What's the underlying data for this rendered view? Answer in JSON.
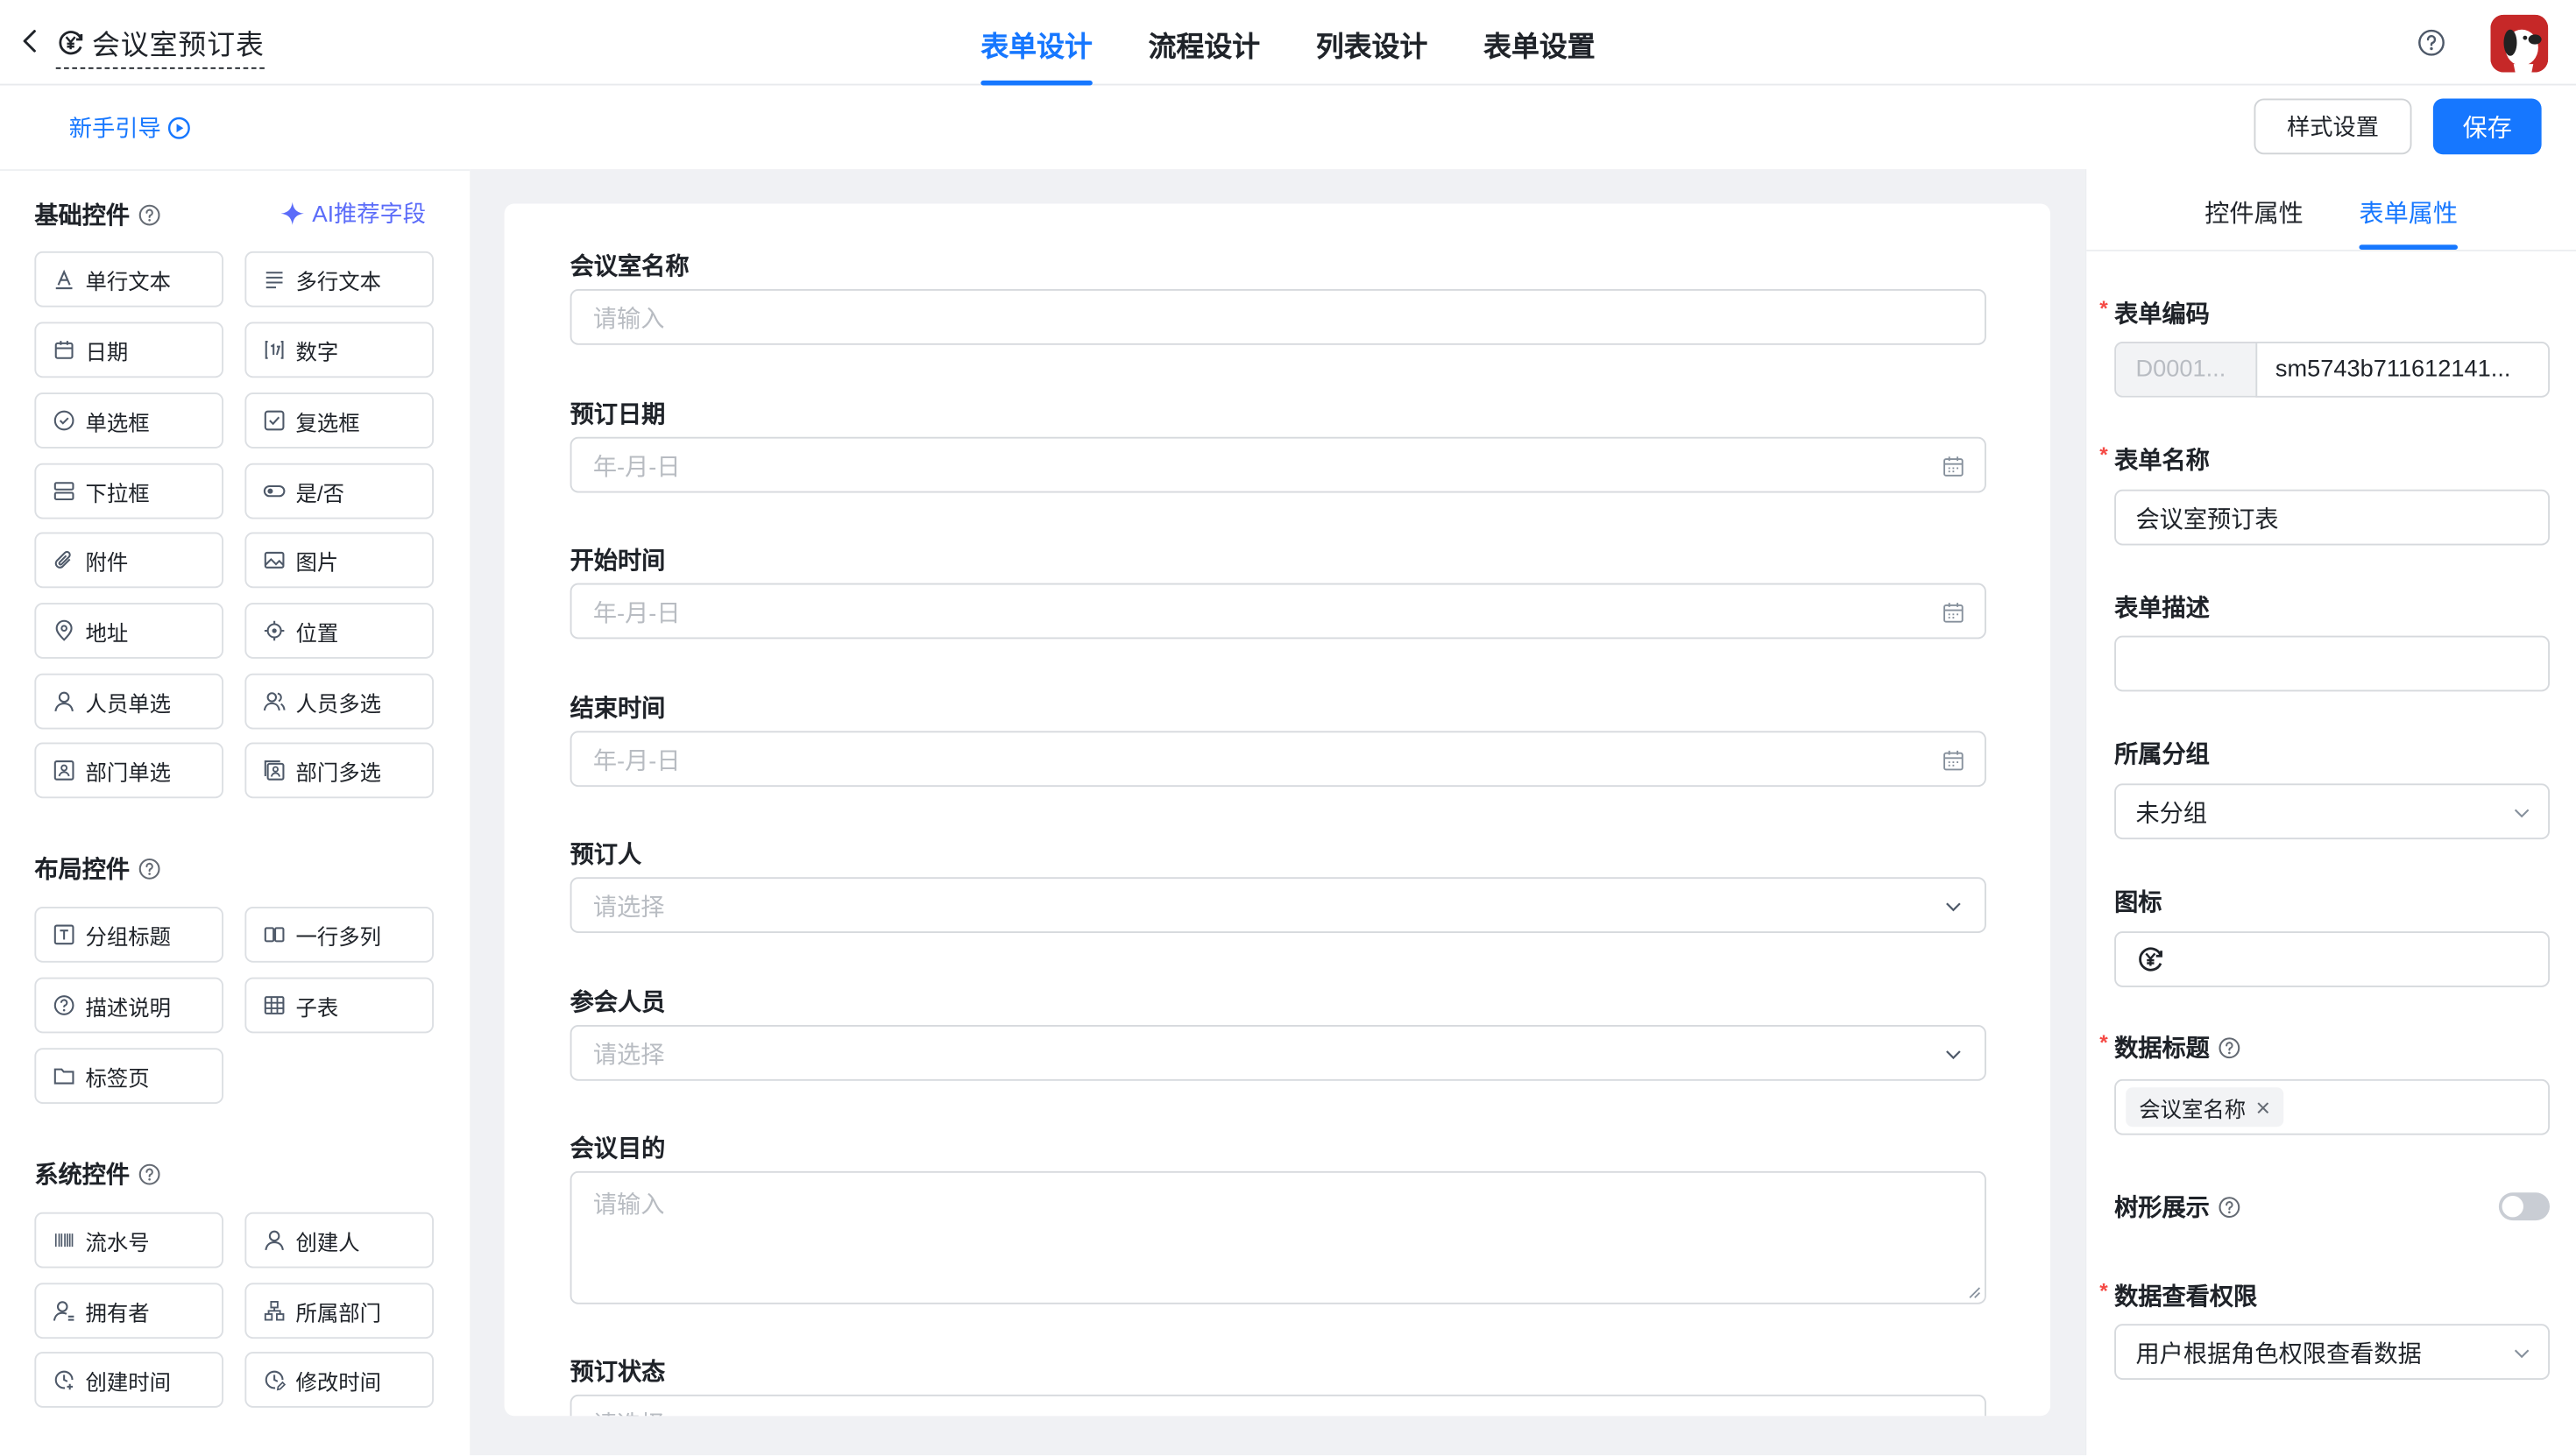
{
  "header": {
    "title": "会议室预订表",
    "tabs": [
      {
        "label": "表单设计",
        "active": true
      },
      {
        "label": "流程设计",
        "active": false
      },
      {
        "label": "列表设计",
        "active": false
      },
      {
        "label": "表单设置",
        "active": false
      }
    ]
  },
  "toolbar": {
    "guide_label": "新手引导",
    "style_button": "样式设置",
    "save_button": "保存"
  },
  "left_panel": {
    "basic": {
      "title": "基础控件",
      "ai_link": "AI推荐字段",
      "items": [
        "单行文本",
        "多行文本",
        "日期",
        "数字",
        "单选框",
        "复选框",
        "下拉框",
        "是/否",
        "附件",
        "图片",
        "地址",
        "位置",
        "人员单选",
        "人员多选",
        "部门单选",
        "部门多选"
      ]
    },
    "layout": {
      "title": "布局控件",
      "items": [
        "分组标题",
        "一行多列",
        "描述说明",
        "子表",
        "标签页"
      ]
    },
    "system": {
      "title": "系统控件",
      "items": [
        "流水号",
        "创建人",
        "拥有者",
        "所属部门",
        "创建时间",
        "修改时间"
      ]
    }
  },
  "form": {
    "fields": [
      {
        "label": "会议室名称",
        "placeholder": "请输入"
      },
      {
        "label": "预订日期",
        "placeholder": "年-月-日"
      },
      {
        "label": "开始时间",
        "placeholder": "年-月-日"
      },
      {
        "label": "结束时间",
        "placeholder": "年-月-日"
      },
      {
        "label": "预订人",
        "placeholder": "请选择"
      },
      {
        "label": "参会人员",
        "placeholder": "请选择"
      },
      {
        "label": "会议目的",
        "placeholder": "请输入"
      },
      {
        "label": "预订状态",
        "placeholder": "请选择"
      }
    ]
  },
  "right_panel": {
    "tabs": [
      {
        "label": "控件属性",
        "active": false
      },
      {
        "label": "表单属性",
        "active": true
      }
    ],
    "form_code": {
      "label": "表单编码",
      "prefix": "D0001...",
      "value": "sm5743b711612141..."
    },
    "form_name": {
      "label": "表单名称",
      "value": "会议室预订表"
    },
    "form_desc": {
      "label": "表单描述",
      "value": ""
    },
    "group": {
      "label": "所属分组",
      "value": "未分组"
    },
    "icon": {
      "label": "图标",
      "icon_name": "yen-cycle-icon"
    },
    "data_title": {
      "label": "数据标题",
      "tag": "会议室名称"
    },
    "tree_view": {
      "label": "树形展示",
      "enabled": false
    },
    "data_permission": {
      "label": "数据查看权限",
      "value": "用户根据角色权限查看数据"
    }
  },
  "colors": {
    "accent": "#1677ff",
    "required": "#f54a45",
    "canvas_bg": "#f0f1f4",
    "ai": "#5b6cf9",
    "avatar_bg": "#c62828"
  }
}
